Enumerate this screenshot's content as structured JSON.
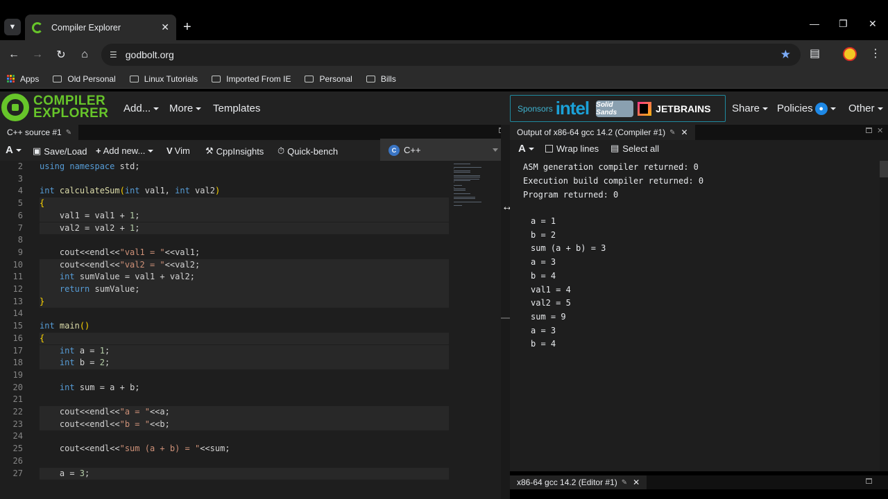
{
  "browser": {
    "tab_title": "Compiler Explorer",
    "url": "godbolt.org",
    "bookmarks": [
      "Apps",
      "Old Personal",
      "Linux Tutorials",
      "Imported From IE",
      "Personal",
      "Bills"
    ]
  },
  "ce": {
    "logo_line1": "COMPILER",
    "logo_line2": "EXPLORER",
    "menu": {
      "add": "Add...",
      "more": "More",
      "templates": "Templates",
      "share": "Share",
      "policies": "Policies",
      "other": "Other"
    },
    "sponsors": {
      "label": "Sponsors",
      "intel": "intel",
      "solid": "Solid Sands",
      "jetbrains": "JETBRAINS"
    }
  },
  "editor": {
    "tab_title": "C++ source #1",
    "toolbar": {
      "font": "A",
      "save_load": "Save/Load",
      "add_new": "Add new...",
      "vim": "Vim",
      "cppinsights": "CppInsights",
      "quickbench": "Quick-bench"
    },
    "language": "C++",
    "lines": [
      {
        "n": "2",
        "html": "<span class='kw'>using</span> <span class='kw'>namespace</span> std;"
      },
      {
        "n": "3",
        "html": ""
      },
      {
        "n": "4",
        "html": "<span class='kw'>int</span> <span class='fn'>calculateSum</span><span class='br'>(</span><span class='kw'>int</span> val1, <span class='kw'>int</span> val2<span class='br'>)</span>"
      },
      {
        "n": "5",
        "html": "<span class='br'>{</span>",
        "hl": true
      },
      {
        "n": "6",
        "html": "    val1 = val1 + <span class='num'>1</span>;",
        "hl": true
      },
      {
        "n": "7",
        "html": "    val2 = val2 + <span class='num'>1</span>;",
        "hl": true
      },
      {
        "n": "8",
        "html": ""
      },
      {
        "n": "9",
        "html": "    cout&lt;&lt;endl&lt;&lt;<span class='str'>\"val1 = \"</span>&lt;&lt;val1;"
      },
      {
        "n": "10",
        "html": "    cout&lt;&lt;endl&lt;&lt;<span class='str'>\"val2 = \"</span>&lt;&lt;val2;",
        "hl": true
      },
      {
        "n": "11",
        "html": "    <span class='kw'>int</span> sumValue = val1 + val2;",
        "hl": true
      },
      {
        "n": "12",
        "html": "    <span class='kw'>return</span> sumValue;",
        "hl": true
      },
      {
        "n": "13",
        "html": "<span class='br'>}</span>",
        "hl": true
      },
      {
        "n": "14",
        "html": ""
      },
      {
        "n": "15",
        "html": "<span class='kw'>int</span> <span class='fn'>main</span><span class='br'>()</span>"
      },
      {
        "n": "16",
        "html": "<span class='br'>{</span>",
        "hl": true
      },
      {
        "n": "17",
        "html": "    <span class='kw'>int</span> a = <span class='num'>1</span>;",
        "hl": true
      },
      {
        "n": "18",
        "html": "    <span class='kw'>int</span> b = <span class='num'>2</span>;",
        "hl": true
      },
      {
        "n": "19",
        "html": ""
      },
      {
        "n": "20",
        "html": "    <span class='kw'>int</span> sum = a + b;"
      },
      {
        "n": "21",
        "html": ""
      },
      {
        "n": "22",
        "html": "    cout&lt;&lt;endl&lt;&lt;<span class='str'>\"a = \"</span>&lt;&lt;a;",
        "hl": true
      },
      {
        "n": "23",
        "html": "    cout&lt;&lt;endl&lt;&lt;<span class='str'>\"b = \"</span>&lt;&lt;b;",
        "hl": true
      },
      {
        "n": "24",
        "html": ""
      },
      {
        "n": "25",
        "html": "    cout&lt;&lt;endl&lt;&lt;<span class='str'>\"sum (a + b) = \"</span>&lt;&lt;sum;"
      },
      {
        "n": "26",
        "html": ""
      },
      {
        "n": "27",
        "html": "    a = <span class='num'>3</span>;",
        "hl": true
      }
    ]
  },
  "output": {
    "tab_title": "Output of x86-64 gcc 14.2 (Compiler #1)",
    "toolbar": {
      "font": "A",
      "wrap": "Wrap lines",
      "select_all": "Select all"
    },
    "status": [
      "ASM generation compiler returned: 0",
      "Execution build compiler returned: 0",
      "Program returned: 0"
    ],
    "stdout": [
      "a = 1",
      "b = 2",
      "sum (a + b) = 3",
      "a = 3",
      "b = 4",
      "val1 = 4",
      "val2 = 5",
      "sum = 9",
      "a = 3",
      "b = 4"
    ],
    "bottom_tab": "x86-64 gcc 14.2 (Editor #1)"
  }
}
